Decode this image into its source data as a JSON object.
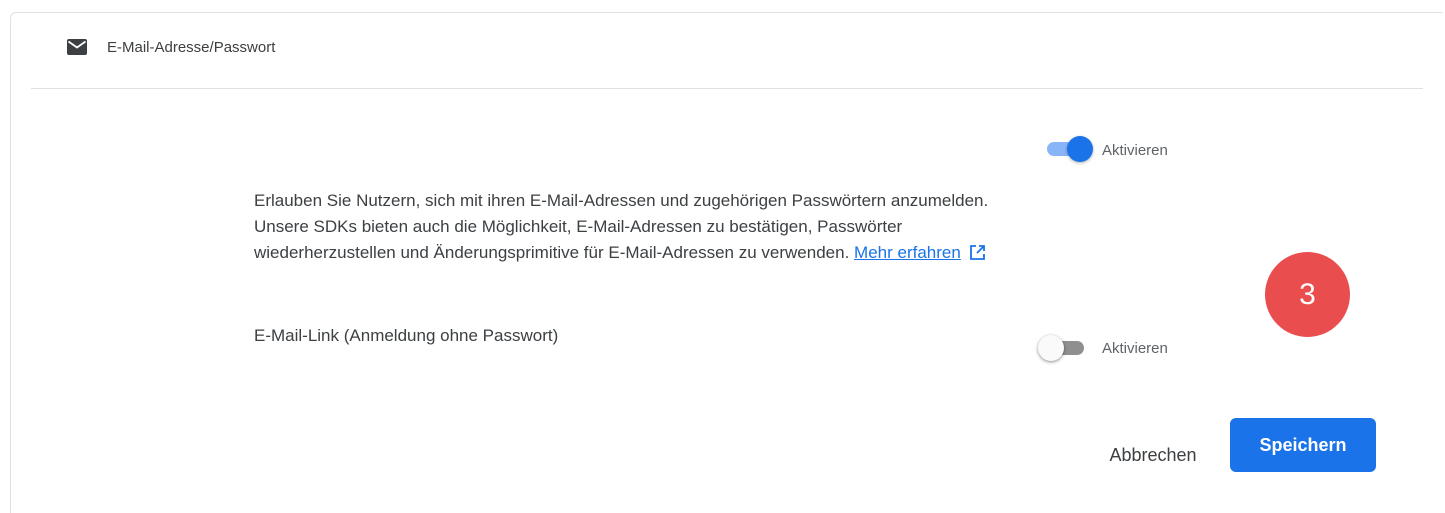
{
  "header": {
    "title": "E-Mail-Adresse/Passwort",
    "icon": "mail-icon"
  },
  "email_password": {
    "toggle_enabled": true,
    "toggle_label": "Aktivieren"
  },
  "description": {
    "line1": "Erlauben Sie Nutzern, sich mit ihren E-Mail-Adressen und zugehörigen Passwörtern anzumelden.",
    "line2": "Unsere SDKs bieten auch die Möglichkeit, E-Mail-Adressen zu bestätigen, Passwörter",
    "line3": "wiederherzustellen und Änderungsprimitive für E-Mail-Adressen zu verwenden.",
    "link_text": "Mehr erfahren",
    "link_icon": "external-link-icon"
  },
  "email_link": {
    "label": "E-Mail-Link (Anmeldung ohne Passwort)",
    "toggle_enabled": false,
    "toggle_label": "Aktivieren"
  },
  "step_badge": "3",
  "actions": {
    "cancel_label": "Abbrechen",
    "save_label": "Speichern"
  },
  "colors": {
    "accent": "#1a73e8",
    "badge": "#ea4d4d"
  }
}
